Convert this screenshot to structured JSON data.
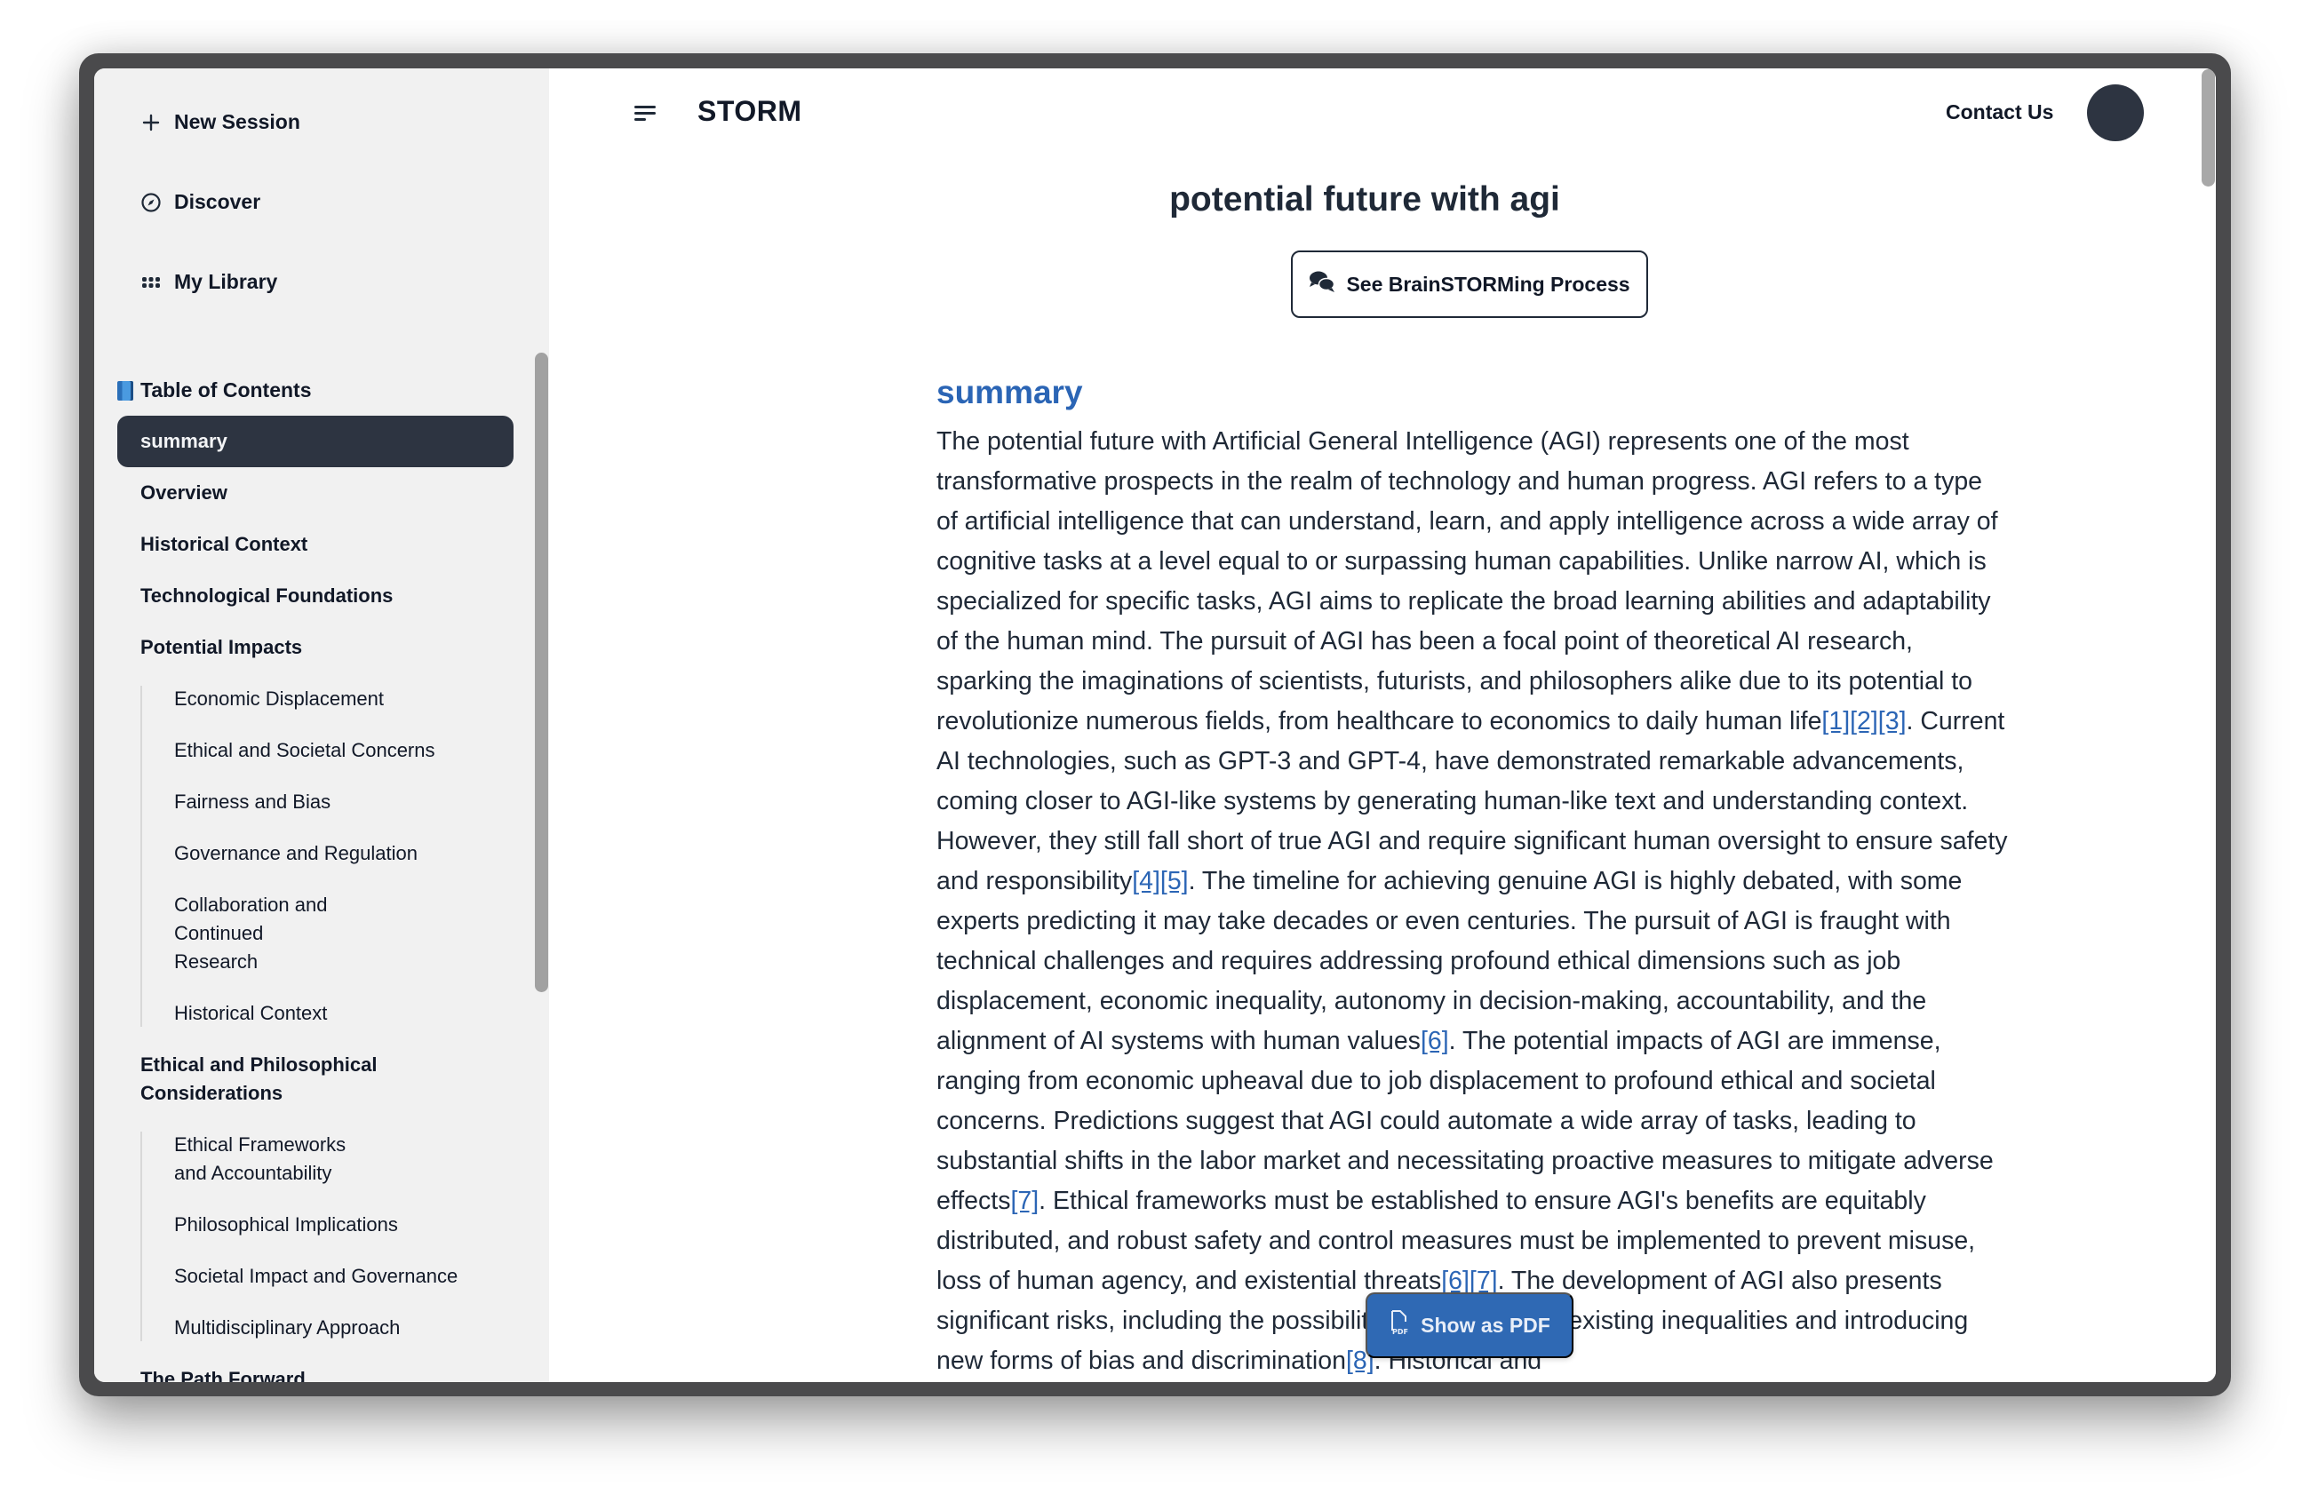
{
  "sidebar": {
    "nav": [
      {
        "label": "New Session",
        "icon": "plus-icon"
      },
      {
        "label": "Discover",
        "icon": "compass-icon"
      },
      {
        "label": "My Library",
        "icon": "grid-icon"
      }
    ],
    "toc_title": "Table of Contents",
    "toc": [
      {
        "label": "summary",
        "level": 1,
        "active": true
      },
      {
        "label": "Overview",
        "level": 1
      },
      {
        "label": "Historical Context",
        "level": 1
      },
      {
        "label": "Technological Foundations",
        "level": 1
      },
      {
        "label": "Potential Impacts",
        "level": 1,
        "children": [
          {
            "label": "Economic Displacement"
          },
          {
            "label": "Ethical and Societal Concerns"
          },
          {
            "label": "Fairness and Bias"
          },
          {
            "label": "Governance and Regulation"
          },
          {
            "label": "Collaboration and Continued Research"
          },
          {
            "label": "Historical Context"
          }
        ]
      },
      {
        "label": "Ethical and Philosophical Considerations",
        "level": 1,
        "children": [
          {
            "label": "Ethical Frameworks and Accountability"
          },
          {
            "label": "Philosophical Implications"
          },
          {
            "label": "Societal Impact and Governance"
          },
          {
            "label": "Multidisciplinary Approach"
          }
        ]
      },
      {
        "label": "The Path Forward",
        "level": 1
      }
    ]
  },
  "header": {
    "brand": "STORM",
    "contact": "Contact Us"
  },
  "document": {
    "title": "potential future with agi",
    "brainstorm_button": "See BrainSTORMing Process",
    "section_heading": "summary",
    "segments": [
      {
        "t": "The potential future with Artificial General Intelligence (AGI) represents one of the most transformative prospects in the realm of technology and human progress. AGI refers to a type of artificial intelligence that can understand, learn, and apply intelligence across a wide array of cognitive tasks at a level equal to or surpassing human capabilities. Unlike narrow AI, which is specialized for specific tasks, AGI aims to replicate the broad learning abilities and adaptability of the human mind. The pursuit of AGI has been a focal point of theoretical AI research, sparking the imaginations of scientists, futurists, and philosophers alike due to its potential to revolutionize numerous fields, from healthcare to economics to daily human life"
      },
      {
        "c": "[1]"
      },
      {
        "c": "[2]"
      },
      {
        "c": "[3]"
      },
      {
        "t": ". Current AI technologies, such as GPT-3 and GPT-4, have demonstrated remarkable advancements, coming closer to AGI-like systems by generating human-like text and understanding context. However, they still fall short of true AGI and require significant human oversight to ensure safety and responsibility"
      },
      {
        "c": "[4]"
      },
      {
        "c": "[5]"
      },
      {
        "t": ". The timeline for achieving genuine AGI is highly debated, with some experts predicting it may take decades or even centuries. The pursuit of AGI is fraught with technical challenges and requires addressing profound ethical dimensions such as job displacement, economic inequality, autonomy in decision-making, accountability, and the alignment of AI systems with human values"
      },
      {
        "c": "[6]"
      },
      {
        "t": ". The potential impacts of AGI are immense, ranging from economic upheaval due to job displacement to profound ethical and societal concerns. Predictions suggest that AGI could automate a wide array of tasks, leading to substantial shifts in the labor market and necessitating proactive measures to mitigate adverse effects"
      },
      {
        "c": "[7]"
      },
      {
        "t": ". Ethical frameworks must be established to ensure AGI's benefits are equitably distributed, and robust safety and control measures must be implemented to prevent misuse, loss of human agency, and existential threats"
      },
      {
        "c": "[6]"
      },
      {
        "c": "[7]"
      },
      {
        "t": ". The development of AGI also presents significant risks, including the possibility of exacerbating existing inequalities and introducing new forms of bias and discrimination"
      },
      {
        "c": "[8]"
      },
      {
        "t": ". Historical and"
      }
    ],
    "pdf_button": "Show as PDF"
  },
  "colors": {
    "accent": "#2b65b5",
    "active_bg": "#2d3441",
    "sidebar_bg": "#f1f1f1",
    "pdf_button_bg": "#2f69b4"
  }
}
